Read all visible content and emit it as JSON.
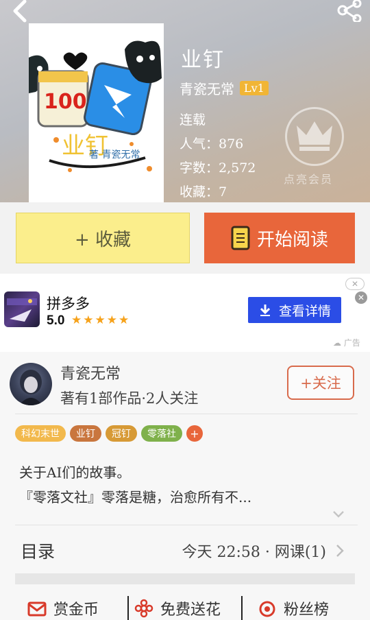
{
  "header": {
    "book_title": "业钉",
    "author": "青瓷无常",
    "level": "Lv1",
    "status": "连载",
    "popularity": "人气：876",
    "word_count": "字数：2,572",
    "favorites": "收藏：7",
    "vip_label": "点亮会员",
    "cover": {
      "badge_text": "100",
      "title_text": "业钉",
      "author_text": "著 青瓷无常"
    }
  },
  "actions": {
    "favorite_label": "+ 收藏",
    "read_label": "开始阅读"
  },
  "ad": {
    "app_name": "拼多多",
    "rating": "5.0",
    "stars": "★★★★★",
    "cta_label": "查看详情",
    "ad_tag": "广告"
  },
  "author_section": {
    "name": "青瓷无常",
    "works": "著有1部作品·2人关注",
    "follow_label": "+关注",
    "tags": [
      {
        "label": "科幻末世",
        "color": "#f2b94d"
      },
      {
        "label": "业钉",
        "color": "#c9763e"
      },
      {
        "label": "冠钉",
        "color": "#d79a36"
      },
      {
        "label": "零落社",
        "color": "#7fb14b"
      }
    ],
    "tag_add": "+",
    "description_line1": "关于AI们的故事。",
    "description_line2": "『零落文社』零落是糖，治愈所有不..."
  },
  "toc": {
    "label": "目录",
    "latest": "今天 22:58 · 网课(1)"
  },
  "bottom_bar": {
    "reward_label": "赏金币",
    "flower_label": "免费送花",
    "fans_label": "粉丝榜"
  },
  "colors": {
    "accent_orange": "#e8663b",
    "favorite_yellow": "#fbee8c",
    "level_badge": "#f1b535",
    "ad_button": "#2b4de6"
  }
}
